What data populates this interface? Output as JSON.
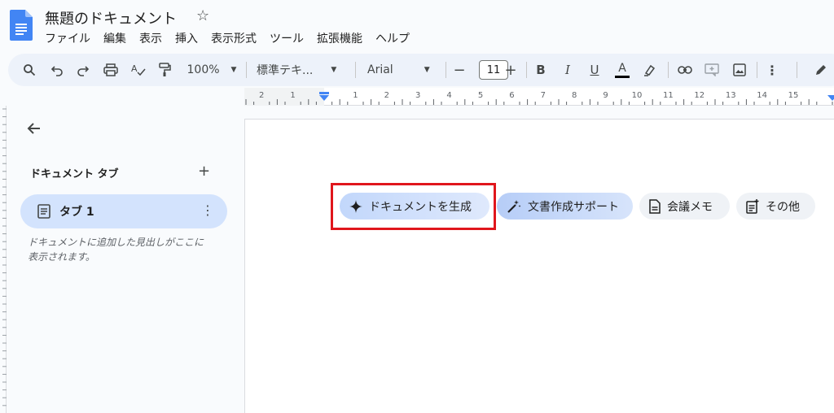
{
  "header": {
    "title": "無題のドキュメント",
    "menu": [
      "ファイル",
      "編集",
      "表示",
      "挿入",
      "表示形式",
      "ツール",
      "拡張機能",
      "ヘルプ"
    ]
  },
  "toolbar": {
    "zoom": "100%",
    "style": "標準テキ...",
    "font": "Arial",
    "font_size": "11"
  },
  "ruler": {
    "labels": [
      "2",
      "1",
      "1",
      "2",
      "3",
      "4",
      "5",
      "6",
      "7",
      "8",
      "9",
      "10",
      "11",
      "12",
      "13",
      "14",
      "15"
    ]
  },
  "sidebar": {
    "heading": "ドキュメント タブ",
    "tab_label": "タブ 1",
    "hint": "ドキュメントに追加した見出しがここに表示されます。"
  },
  "chips": {
    "generate": "ドキュメントを生成",
    "assist": "文書作成サポート",
    "notes": "会議メモ",
    "other": "その他"
  },
  "colors": {
    "highlight": "#e0161c",
    "text_color_underline": "#000000",
    "active_tab": "#d3e3fd"
  }
}
